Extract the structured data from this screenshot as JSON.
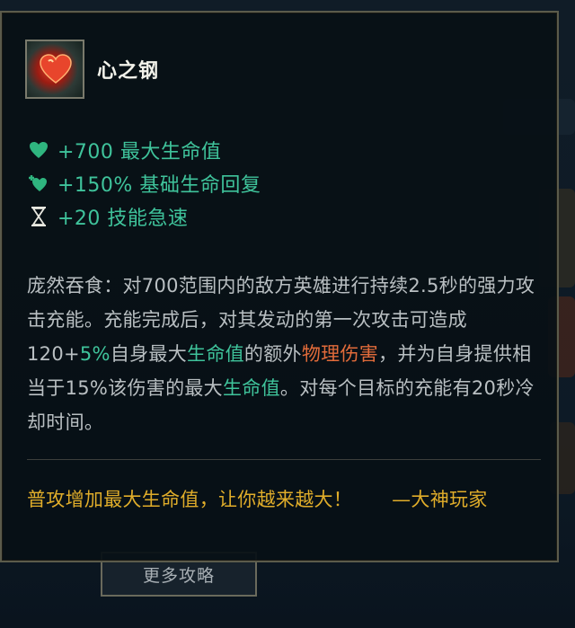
{
  "item": {
    "name": "心之钢",
    "icon": "heartsteel-item-icon"
  },
  "stats": [
    {
      "icon": "heart-icon",
      "text": "+700 最大生命值"
    },
    {
      "icon": "health-regen-icon",
      "text": "+150% 基础生命回复"
    },
    {
      "icon": "hourglass-icon",
      "text": "+20 技能急速"
    }
  ],
  "description": {
    "p1": "庞然吞食：对700范围内的敌方英雄进行持续2.5秒的强力攻击充能。充能完成后，对其发动的第一次攻击可造成120+",
    "p2": "5%",
    "p3": "自身最大",
    "p4": "生命值",
    "p5": "的额外",
    "p6": "物理伤害",
    "p7": "，并为自身提供相当于15%该伤害的最大",
    "p8": "生命值",
    "p9": "。对每个目标的充能有20秒冷却时间。"
  },
  "tip": {
    "text": "普攻增加最大生命值，让你越来越大！",
    "author": "—大神玩家"
  },
  "more_button": {
    "label": "更多攻略"
  },
  "colors": {
    "stat_green": "#3fc39b",
    "damage_orange": "#e26b3a",
    "tip_gold": "#e0ad2a"
  }
}
